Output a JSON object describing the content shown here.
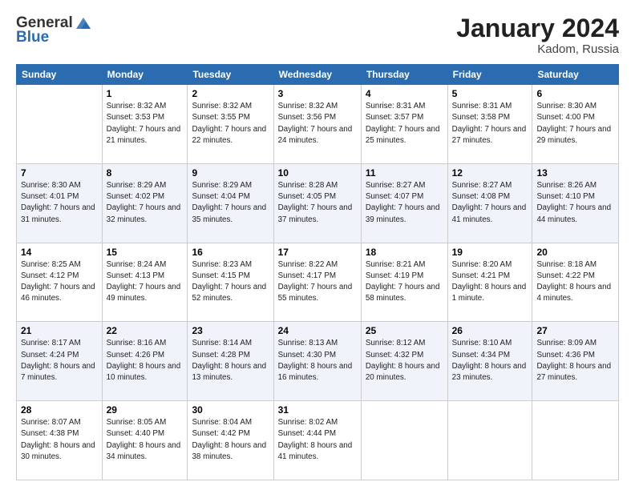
{
  "header": {
    "logo_general": "General",
    "logo_blue": "Blue",
    "month_title": "January 2024",
    "location": "Kadom, Russia"
  },
  "days_of_week": [
    "Sunday",
    "Monday",
    "Tuesday",
    "Wednesday",
    "Thursday",
    "Friday",
    "Saturday"
  ],
  "weeks": [
    [
      {
        "day": "",
        "sunrise": "",
        "sunset": "",
        "daylight": ""
      },
      {
        "day": "1",
        "sunrise": "Sunrise: 8:32 AM",
        "sunset": "Sunset: 3:53 PM",
        "daylight": "Daylight: 7 hours and 21 minutes."
      },
      {
        "day": "2",
        "sunrise": "Sunrise: 8:32 AM",
        "sunset": "Sunset: 3:55 PM",
        "daylight": "Daylight: 7 hours and 22 minutes."
      },
      {
        "day": "3",
        "sunrise": "Sunrise: 8:32 AM",
        "sunset": "Sunset: 3:56 PM",
        "daylight": "Daylight: 7 hours and 24 minutes."
      },
      {
        "day": "4",
        "sunrise": "Sunrise: 8:31 AM",
        "sunset": "Sunset: 3:57 PM",
        "daylight": "Daylight: 7 hours and 25 minutes."
      },
      {
        "day": "5",
        "sunrise": "Sunrise: 8:31 AM",
        "sunset": "Sunset: 3:58 PM",
        "daylight": "Daylight: 7 hours and 27 minutes."
      },
      {
        "day": "6",
        "sunrise": "Sunrise: 8:30 AM",
        "sunset": "Sunset: 4:00 PM",
        "daylight": "Daylight: 7 hours and 29 minutes."
      }
    ],
    [
      {
        "day": "7",
        "sunrise": "Sunrise: 8:30 AM",
        "sunset": "Sunset: 4:01 PM",
        "daylight": "Daylight: 7 hours and 31 minutes."
      },
      {
        "day": "8",
        "sunrise": "Sunrise: 8:29 AM",
        "sunset": "Sunset: 4:02 PM",
        "daylight": "Daylight: 7 hours and 32 minutes."
      },
      {
        "day": "9",
        "sunrise": "Sunrise: 8:29 AM",
        "sunset": "Sunset: 4:04 PM",
        "daylight": "Daylight: 7 hours and 35 minutes."
      },
      {
        "day": "10",
        "sunrise": "Sunrise: 8:28 AM",
        "sunset": "Sunset: 4:05 PM",
        "daylight": "Daylight: 7 hours and 37 minutes."
      },
      {
        "day": "11",
        "sunrise": "Sunrise: 8:27 AM",
        "sunset": "Sunset: 4:07 PM",
        "daylight": "Daylight: 7 hours and 39 minutes."
      },
      {
        "day": "12",
        "sunrise": "Sunrise: 8:27 AM",
        "sunset": "Sunset: 4:08 PM",
        "daylight": "Daylight: 7 hours and 41 minutes."
      },
      {
        "day": "13",
        "sunrise": "Sunrise: 8:26 AM",
        "sunset": "Sunset: 4:10 PM",
        "daylight": "Daylight: 7 hours and 44 minutes."
      }
    ],
    [
      {
        "day": "14",
        "sunrise": "Sunrise: 8:25 AM",
        "sunset": "Sunset: 4:12 PM",
        "daylight": "Daylight: 7 hours and 46 minutes."
      },
      {
        "day": "15",
        "sunrise": "Sunrise: 8:24 AM",
        "sunset": "Sunset: 4:13 PM",
        "daylight": "Daylight: 7 hours and 49 minutes."
      },
      {
        "day": "16",
        "sunrise": "Sunrise: 8:23 AM",
        "sunset": "Sunset: 4:15 PM",
        "daylight": "Daylight: 7 hours and 52 minutes."
      },
      {
        "day": "17",
        "sunrise": "Sunrise: 8:22 AM",
        "sunset": "Sunset: 4:17 PM",
        "daylight": "Daylight: 7 hours and 55 minutes."
      },
      {
        "day": "18",
        "sunrise": "Sunrise: 8:21 AM",
        "sunset": "Sunset: 4:19 PM",
        "daylight": "Daylight: 7 hours and 58 minutes."
      },
      {
        "day": "19",
        "sunrise": "Sunrise: 8:20 AM",
        "sunset": "Sunset: 4:21 PM",
        "daylight": "Daylight: 8 hours and 1 minute."
      },
      {
        "day": "20",
        "sunrise": "Sunrise: 8:18 AM",
        "sunset": "Sunset: 4:22 PM",
        "daylight": "Daylight: 8 hours and 4 minutes."
      }
    ],
    [
      {
        "day": "21",
        "sunrise": "Sunrise: 8:17 AM",
        "sunset": "Sunset: 4:24 PM",
        "daylight": "Daylight: 8 hours and 7 minutes."
      },
      {
        "day": "22",
        "sunrise": "Sunrise: 8:16 AM",
        "sunset": "Sunset: 4:26 PM",
        "daylight": "Daylight: 8 hours and 10 minutes."
      },
      {
        "day": "23",
        "sunrise": "Sunrise: 8:14 AM",
        "sunset": "Sunset: 4:28 PM",
        "daylight": "Daylight: 8 hours and 13 minutes."
      },
      {
        "day": "24",
        "sunrise": "Sunrise: 8:13 AM",
        "sunset": "Sunset: 4:30 PM",
        "daylight": "Daylight: 8 hours and 16 minutes."
      },
      {
        "day": "25",
        "sunrise": "Sunrise: 8:12 AM",
        "sunset": "Sunset: 4:32 PM",
        "daylight": "Daylight: 8 hours and 20 minutes."
      },
      {
        "day": "26",
        "sunrise": "Sunrise: 8:10 AM",
        "sunset": "Sunset: 4:34 PM",
        "daylight": "Daylight: 8 hours and 23 minutes."
      },
      {
        "day": "27",
        "sunrise": "Sunrise: 8:09 AM",
        "sunset": "Sunset: 4:36 PM",
        "daylight": "Daylight: 8 hours and 27 minutes."
      }
    ],
    [
      {
        "day": "28",
        "sunrise": "Sunrise: 8:07 AM",
        "sunset": "Sunset: 4:38 PM",
        "daylight": "Daylight: 8 hours and 30 minutes."
      },
      {
        "day": "29",
        "sunrise": "Sunrise: 8:05 AM",
        "sunset": "Sunset: 4:40 PM",
        "daylight": "Daylight: 8 hours and 34 minutes."
      },
      {
        "day": "30",
        "sunrise": "Sunrise: 8:04 AM",
        "sunset": "Sunset: 4:42 PM",
        "daylight": "Daylight: 8 hours and 38 minutes."
      },
      {
        "day": "31",
        "sunrise": "Sunrise: 8:02 AM",
        "sunset": "Sunset: 4:44 PM",
        "daylight": "Daylight: 8 hours and 41 minutes."
      },
      {
        "day": "",
        "sunrise": "",
        "sunset": "",
        "daylight": ""
      },
      {
        "day": "",
        "sunrise": "",
        "sunset": "",
        "daylight": ""
      },
      {
        "day": "",
        "sunrise": "",
        "sunset": "",
        "daylight": ""
      }
    ]
  ]
}
